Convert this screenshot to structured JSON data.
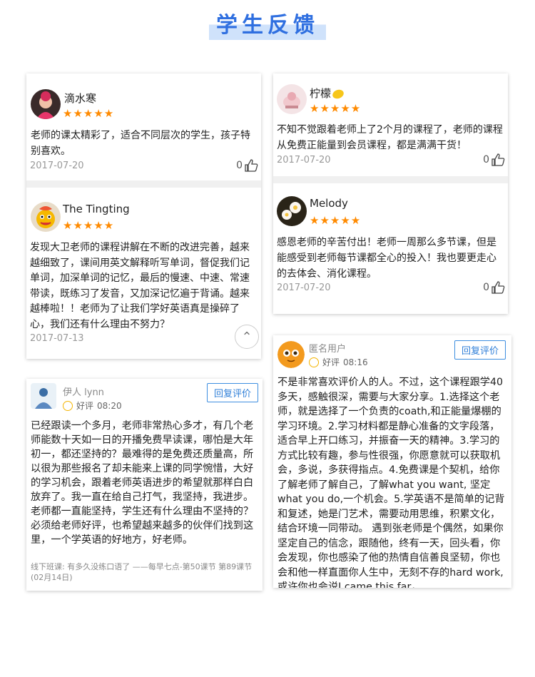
{
  "page": {
    "title": "学生反馈"
  },
  "cards": {
    "c1": {
      "user": "滴水寒",
      "stars": "★★★★★",
      "text": "老师的课太精彩了，适合不同层次的学生，孩子特别喜欢。",
      "date": "2017-07-20",
      "likes": "0"
    },
    "c2": {
      "user": "柠檬",
      "stars": "★★★★★",
      "text": "不知不觉跟着老师上了2个月的课程了，老师的课程从免费正能量到会员课程，都是满满干货！",
      "date": "2017-07-20",
      "likes": "0"
    },
    "c3": {
      "user": "The Tingting",
      "stars": "★★★★★",
      "text": "发现大卫老师的课程讲解在不断的改进完善，越来越细致了，课间用英文解释听写单词，督促我们记单词，加深单词的记忆，最后的慢速、中速、常速带读，既练习了发音，又加深记忆遍于背诵。越来越棒啦！！老师为了让我们学好英语真是操碎了心，我们还有什么理由不努力？",
      "date": "2017-07-13"
    },
    "c4": {
      "user": "Melody",
      "stars": "★★★★★",
      "text": "感恩老师的辛苦付出！老师一周那么多节课，但是能感受到老师每节课都全心的投入！我也要更走心的去体会、消化课程。",
      "date": "2017-07-20",
      "likes": "0"
    },
    "c5": {
      "user": "伊人 lynn",
      "rating": "好评",
      "time": "08:20",
      "reply": "回复评价",
      "text": "已经跟读一个多月，老师非常热心多才，有几个老师能数十天如一日的开播免费早读课，哪怕是大年初一，都还坚持的？最难得的是免费还质量高，所以很为那些报名了却未能来上课的同学惋惜，大好的学习机会，跟着老师英语进步的希望就那样白白放弃了。我一直在给自己打气，我坚持，我进步。老师都一直能坚持，学生还有什么理由不坚持的？必须给老师好评，也希望越来越多的伙伴们找到这里，一个学英语的好地方，好老师。",
      "footnote": "线下班课: 有多久没练口语了 ——每早七点-第50课节 第89课节(02月14日)"
    },
    "c6": {
      "user": "匿名用户",
      "rating": "好评",
      "time": "08:16",
      "reply": "回复评价",
      "text": "不是非常喜欢评价人的人。不过，这个课程跟学40多天，感触很深，需要与大家分享。1.选择这个老师，就是选择了一个负责的coath,和正能量爆棚的学习环境。2.学习材料都是静心准备的文字段落，适合早上开口练习，并振奋一天的精神。3.学习的方式比较有趣，参与性很强，你愿意就可以获取机会，多说，多获得指点。4.免费课是个契机，给你了解老师了解自己，了解what you want, 坚定 what you do,一个机会。5.学英语不是简单的记背和复述，她是门艺术，需要动用思维，积累文化，结合环境一同带动。 遇到张老师是个偶然，如果你坚定自己的信念，跟随他，终有一天，回头看，你会发现，你也感染了他的热情自信善良坚韧，你也会和他一样直面你人生中，无刻不存的hard work,或许你也会说I came this far，"
    }
  },
  "icons": {
    "thumb": "thumbs-up-icon",
    "smile": "smile-icon",
    "scroll": "scroll-top-icon"
  },
  "colors": {
    "accent": "#2f6fe0",
    "star": "#ff8a00",
    "reply": "#3d8ee0"
  }
}
